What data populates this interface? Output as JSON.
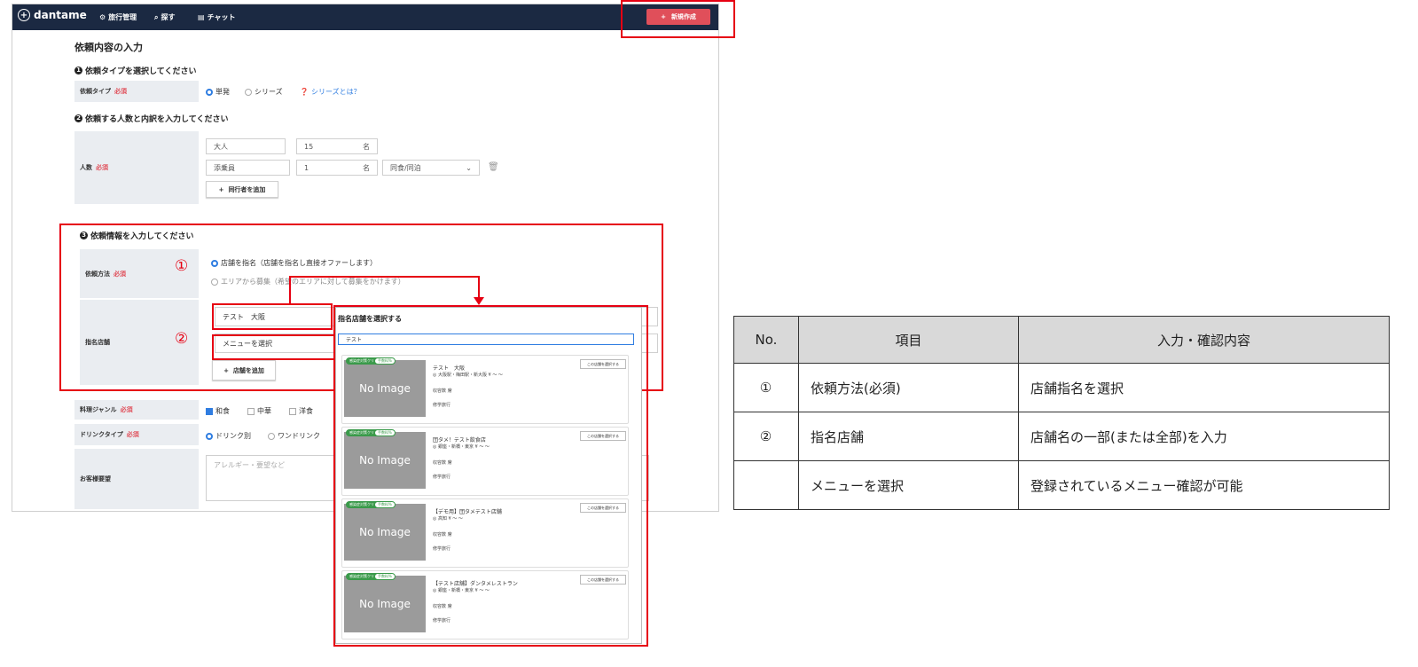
{
  "app": {
    "logo": "dantame",
    "nav": [
      {
        "icon": "gear-icon",
        "label": "旅行管理"
      },
      {
        "icon": "search-icon",
        "label": "探す"
      },
      {
        "icon": "chat-icon",
        "label": "チャット"
      }
    ],
    "new_button": "新規作成"
  },
  "form": {
    "title": "依頼内容の入力",
    "step1": {
      "num": "1",
      "heading": "依頼タイプを選択してください",
      "label": "依頼タイプ",
      "required": "必須",
      "options": [
        "単発",
        "シリーズ"
      ],
      "help": "シリーズとは？"
    },
    "step2": {
      "num": "2",
      "heading": "依頼する人数と内訳を入力してください",
      "label": "人数",
      "required": "必須",
      "rows": [
        {
          "type": "大人",
          "count": "15",
          "unit": "名"
        },
        {
          "type": "添乗員",
          "count": "1",
          "unit": "名",
          "select": "同食/同泊"
        }
      ],
      "add_button": "同行者を追加"
    },
    "step3": {
      "num": "3",
      "heading": "依頼情報を入力してください",
      "method_label": "依頼方法",
      "required": "必須",
      "method_options": [
        "店舗を指名（店舗を指名し直接オファーします）",
        "エリアから募集（希望のエリアに対して募集をかけます）"
      ],
      "store_label": "指名店舗",
      "store_value": "テスト　大阪",
      "menu_placeholder": "メニューを選択",
      "add_store_button": "店舗を追加"
    },
    "genre": {
      "label": "料理ジャンル",
      "required": "必須",
      "options": [
        "和食",
        "中華",
        "洋食"
      ]
    },
    "drink": {
      "label": "ドリンクタイプ",
      "required": "必須",
      "options": [
        "ドリンク別",
        "ワンドリンク"
      ]
    },
    "request": {
      "label": "お客様要望",
      "placeholder": "アレルギー・要望など"
    }
  },
  "markers": {
    "one": "①",
    "two": "②"
  },
  "dialog": {
    "title": "指名店舗を選択する",
    "search_value": "テスト",
    "no_image": "No Image",
    "badge1": "感染症対策クリア",
    "badge2": "手数料%",
    "pick_button": "この店舗を選択する",
    "cards": [
      {
        "name": "テスト　大阪",
        "address": "◎ 大阪駅・梅田駅・新大阪 ¥ ～ ～",
        "seats": "収容数 席",
        "trip": "修学旅行"
      },
      {
        "name": "団タメ！テスト飲食店",
        "address": "◎ 銀座・新橋・東京 ¥ ～ ～",
        "seats": "収容数 席",
        "trip": "修学旅行"
      },
      {
        "name": "【デモ用】団タメテスト店舗",
        "address": "◎ 高知 ¥ ～ ～",
        "seats": "収容数 席",
        "trip": "修学旅行"
      },
      {
        "name": "【テスト店舗】ダンタメレストラン",
        "address": "◎ 銀座・新橋・東京 ¥ ～ ～",
        "seats": "収容数 席",
        "trip": "修学旅行"
      }
    ]
  },
  "table": {
    "headers": [
      "No.",
      "項目",
      "入力・確認内容"
    ],
    "rows": [
      {
        "no": "①",
        "item": "依頼方法(必須)",
        "content": "店舗指名を選択"
      },
      {
        "no": "②",
        "item": "指名店舗",
        "content": "店舗名の一部(または全部)を入力"
      },
      {
        "no": "",
        "item": "メニューを選択",
        "content": "登録されているメニュー確認が可能"
      }
    ]
  },
  "colors": {
    "annotation": "#e60012",
    "topbar": "#1b2942",
    "primary": "#e04f5a",
    "accent": "#2f7de1"
  }
}
